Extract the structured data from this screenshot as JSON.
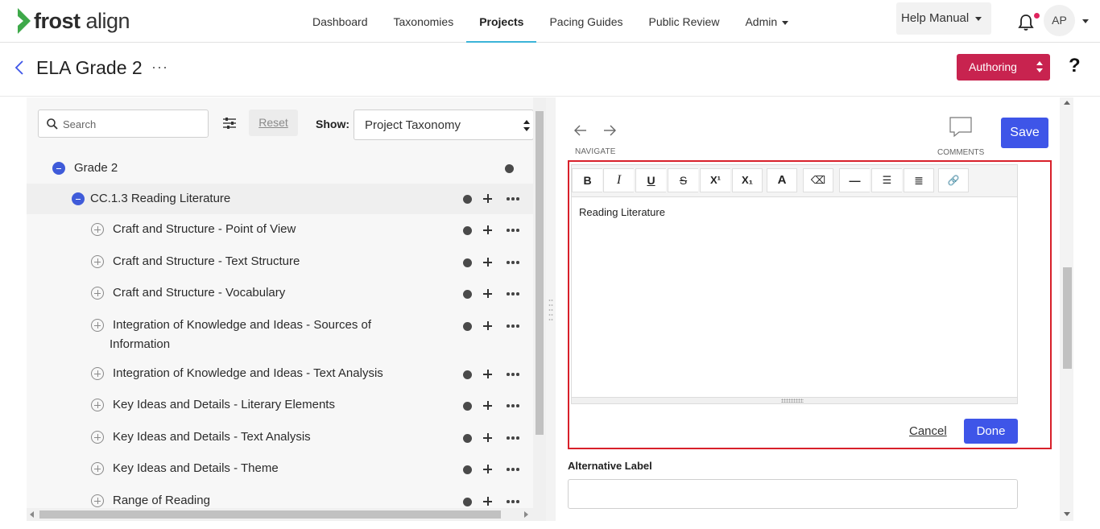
{
  "brand": {
    "logo_bold": "frost",
    "logo_light": " align",
    "accent": "#3cb4d8"
  },
  "nav": {
    "items": [
      {
        "label": "Dashboard"
      },
      {
        "label": "Taxonomies"
      },
      {
        "label": "Projects",
        "active": true
      },
      {
        "label": "Pacing Guides"
      },
      {
        "label": "Public Review"
      },
      {
        "label": "Admin",
        "dropdown": true
      }
    ],
    "help_label": "Help Manual",
    "avatar_initials": "AP"
  },
  "header": {
    "title": "ELA Grade 2",
    "more": "···",
    "mode_label": "Authoring",
    "mode_color": "#c8234f",
    "help_symbol": "?"
  },
  "left": {
    "search_placeholder": "Search",
    "reset_label": "Reset",
    "show_label": "Show:",
    "show_value": "Project Taxonomy",
    "tree": [
      {
        "label": "Grade 2",
        "level": 0,
        "expanded": true
      },
      {
        "label": "CC.1.3 Reading Literature",
        "level": 1,
        "expanded": true
      },
      {
        "label": "Craft and Structure - Point of View",
        "level": 2
      },
      {
        "label": "Craft and Structure - Text Structure",
        "level": 2
      },
      {
        "label": "Craft and Structure - Vocabulary",
        "level": 2
      },
      {
        "label": "Integration of Knowledge and Ideas - Sources of",
        "label2": "Information",
        "level": 2
      },
      {
        "label": "Integration of Knowledge and Ideas - Text Analysis",
        "level": 2
      },
      {
        "label": "Key Ideas and Details - Literary Elements",
        "level": 2
      },
      {
        "label": "Key Ideas and Details - Text Analysis",
        "level": 2
      },
      {
        "label": "Key Ideas and Details - Theme",
        "level": 2
      },
      {
        "label": "Range of Reading",
        "level": 2
      }
    ]
  },
  "right": {
    "navigate_caption": "NAVIGATE",
    "comments_caption": "COMMENTS",
    "save_label": "Save",
    "toolbar": [
      {
        "name": "bold",
        "glyph": "B"
      },
      {
        "name": "italic",
        "glyph": "I"
      },
      {
        "name": "underline",
        "glyph": "U"
      },
      {
        "name": "strikethrough",
        "glyph": "S"
      },
      {
        "name": "superscript",
        "glyph": "X¹"
      },
      {
        "name": "subscript",
        "glyph": "X₁"
      },
      {
        "name": "font-color",
        "glyph": "A"
      },
      {
        "name": "clear-format",
        "glyph": "⌫"
      },
      {
        "name": "horizontal-rule",
        "glyph": "—"
      },
      {
        "name": "bullet-list",
        "glyph": "☰"
      },
      {
        "name": "numbered-list",
        "glyph": "≣"
      },
      {
        "name": "link",
        "glyph": "🔗"
      }
    ],
    "editor_text": "Reading Literature",
    "cancel_label": "Cancel",
    "done_label": "Done",
    "alt_label": "Alternative Label",
    "alt_value": "",
    "button_color": "#3e55e8",
    "highlight_border_color": "#d8202a"
  }
}
